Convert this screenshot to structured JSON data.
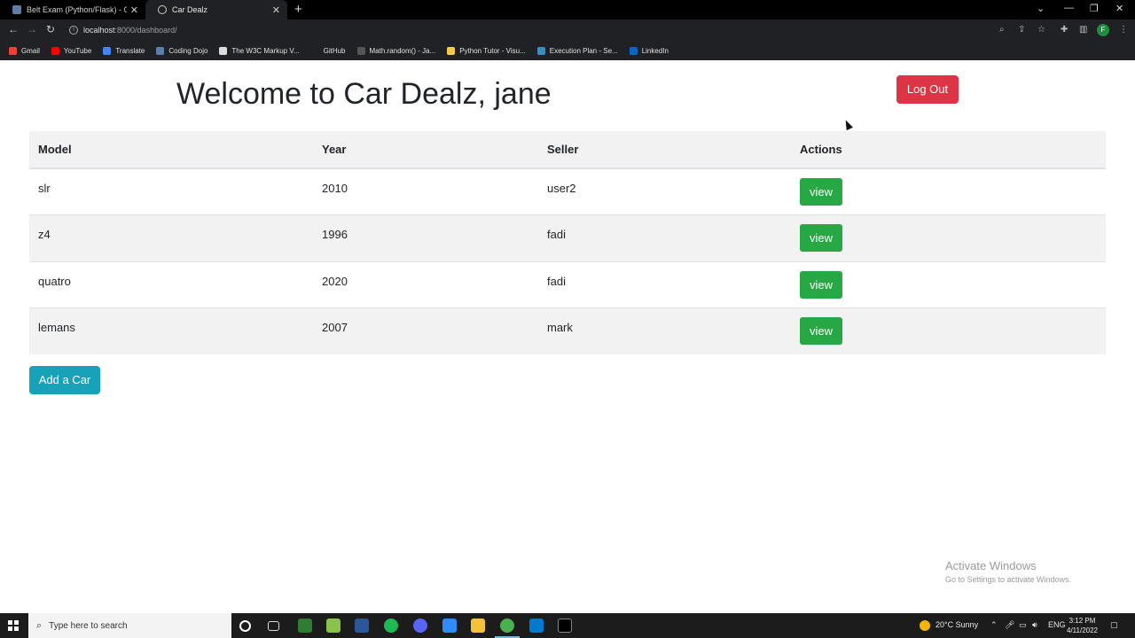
{
  "browser": {
    "tabs": [
      {
        "title": "Belt Exam (Python/Flask) - Optio",
        "active": false
      },
      {
        "title": "Car Dealz",
        "active": true
      }
    ],
    "url_host": "localhost",
    "url_path": ":8000/dashboard/",
    "profile_initial": "F",
    "bookmarks": [
      "Gmail",
      "YouTube",
      "Translate",
      "Coding Dojo",
      "The W3C Markup V...",
      "GitHub",
      "Math.random() - Ja...",
      "Python Tutor - Visu...",
      "Execution Plan - Se...",
      "LinkedIn"
    ]
  },
  "page": {
    "welcome": "Welcome to Car Dealz, jane",
    "logout_label": "Log Out",
    "columns": [
      "Model",
      "Year",
      "Seller",
      "Actions"
    ],
    "rows": [
      {
        "model": "slr",
        "year": "2010",
        "seller": "user2",
        "action": "view"
      },
      {
        "model": "z4",
        "year": "1996",
        "seller": "fadi",
        "action": "view"
      },
      {
        "model": "quatro",
        "year": "2020",
        "seller": "fadi",
        "action": "view"
      },
      {
        "model": "lemans",
        "year": "2007",
        "seller": "mark",
        "action": "view"
      }
    ],
    "add_car_label": "Add a Car"
  },
  "watermark": {
    "line1": "Activate Windows",
    "line2": "Go to Settings to activate Windows."
  },
  "taskbar": {
    "search_placeholder": "Type here to search",
    "weather": "20°C  Sunny",
    "language": "ENG",
    "time": "3:12 PM",
    "date": "4/11/2022"
  },
  "colors": {
    "danger": "#dc3545",
    "success": "#28a745",
    "info": "#17a2b8"
  }
}
